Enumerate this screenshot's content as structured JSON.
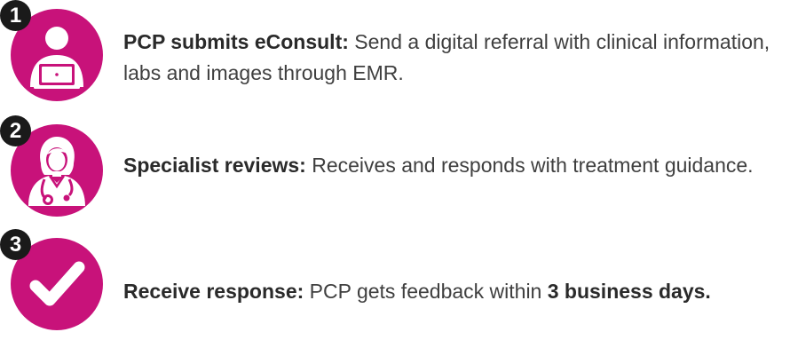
{
  "colors": {
    "accent": "#c8127a",
    "badge": "#1a1a1a",
    "text": "#3f3f3f"
  },
  "steps": [
    {
      "number": "1",
      "icon": "person-laptop-icon",
      "title": "PCP submits eConsult:",
      "body": " Send a digital referral with clinical information, labs and images through EMR."
    },
    {
      "number": "2",
      "icon": "doctor-stethoscope-icon",
      "title": "Specialist reviews:",
      "body": " Receives and responds with treatment guidance."
    },
    {
      "number": "3",
      "icon": "checkmark-icon",
      "title": "Receive response:",
      "body_before": " PCP gets feedback within ",
      "body_bold": "3 business days."
    }
  ]
}
